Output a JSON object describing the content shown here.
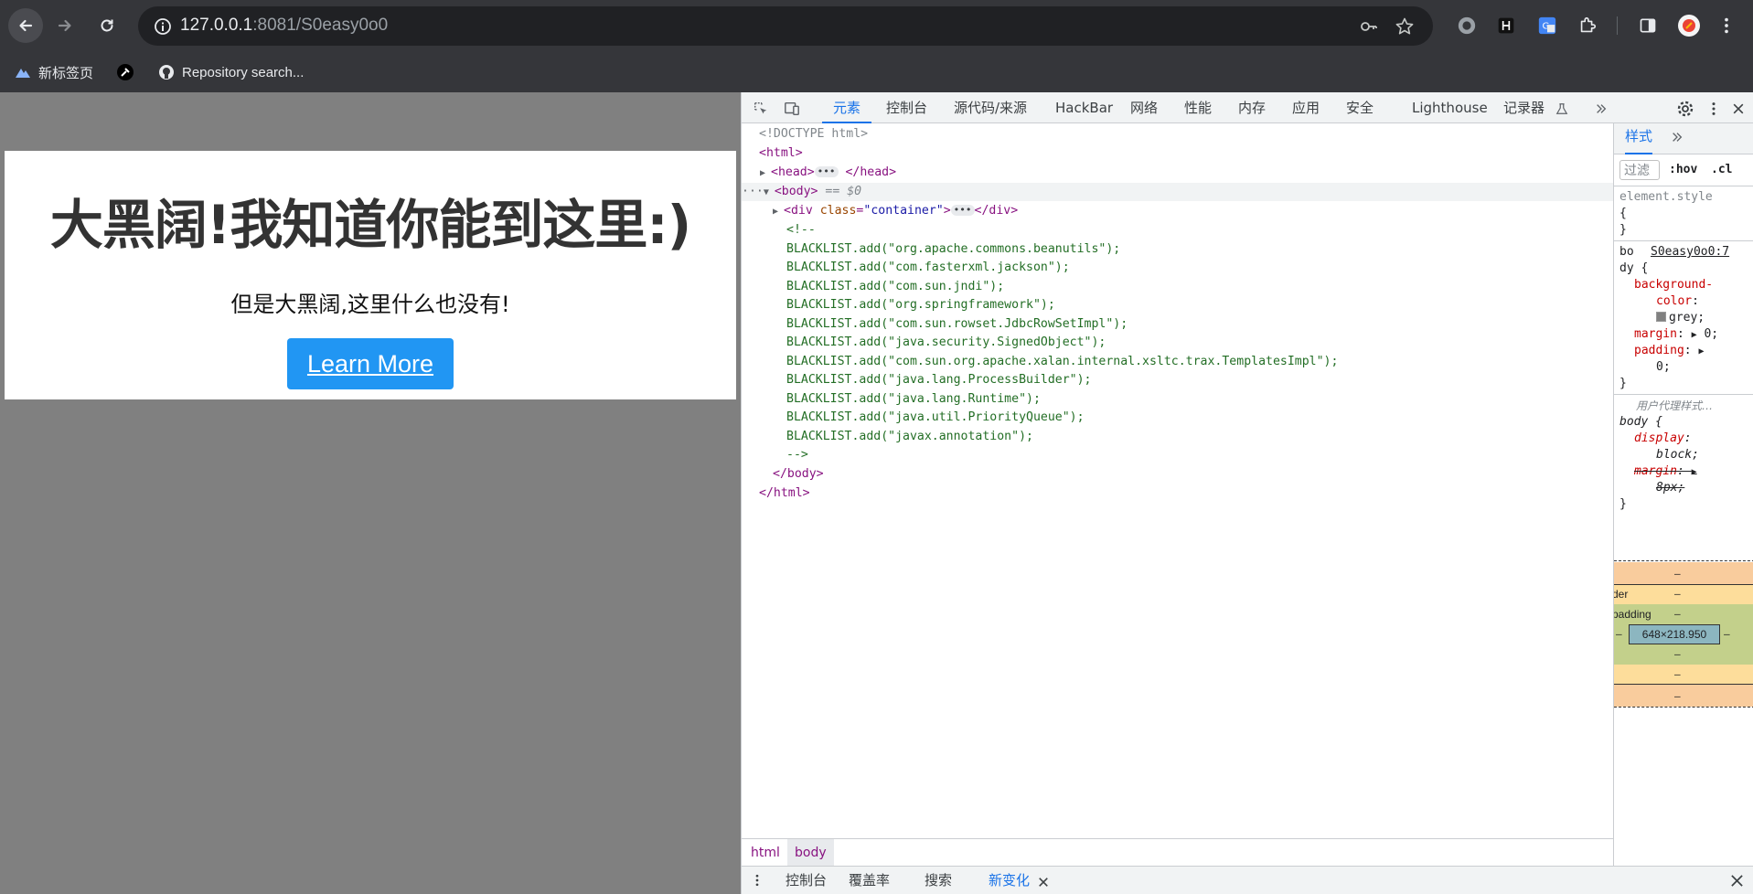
{
  "browser": {
    "url_host": "127.0.0.1",
    "url_rest": ":8081/S0easy0o0",
    "bookmarks": [
      {
        "label": "新标签页",
        "icon": "mountain-icon"
      },
      {
        "label": "",
        "icon": "tool-icon"
      },
      {
        "label": "Repository search...",
        "icon": "github-icon"
      }
    ]
  },
  "page": {
    "heading": "大黑阔!我知道你能到这里:)",
    "subtext": "但是大黑阔,这里什么也没有!",
    "button": "Learn More"
  },
  "devtools": {
    "tabs": [
      "元素",
      "控制台",
      "源代码/来源",
      "HackBar",
      "网络",
      "性能",
      "内存",
      "应用",
      "安全",
      "Lighthouse",
      "记录器"
    ],
    "dom": {
      "doctype": "<!DOCTYPE html>",
      "html_open": "<html>",
      "head": "<head>",
      "head_close": "</head>",
      "body_open": "<body>",
      "body_eq": "== $0",
      "div_open": "<div",
      "div_attr": "class",
      "div_attr_val": "\"container\"",
      "div_close": "</div>",
      "comment_open": "<!--",
      "blacklist": [
        "BLACKLIST.add(\"org.apache.commons.beanutils\");",
        "BLACKLIST.add(\"com.fasterxml.jackson\");",
        "BLACKLIST.add(\"com.sun.jndi\");",
        "BLACKLIST.add(\"org.springframework\");",
        "BLACKLIST.add(\"com.sun.rowset.JdbcRowSetImpl\");",
        "BLACKLIST.add(\"java.security.SignedObject\");",
        "BLACKLIST.add(\"com.sun.org.apache.xalan.internal.xsltc.trax.TemplatesImpl\");",
        "BLACKLIST.add(\"java.lang.ProcessBuilder\");",
        "BLACKLIST.add(\"java.lang.Runtime\");",
        "BLACKLIST.add(\"java.util.PriorityQueue\");",
        "BLACKLIST.add(\"javax.annotation\");"
      ],
      "comment_close": "-->",
      "body_close": "</body>",
      "html_close": "</html>"
    },
    "breadcrumbs": [
      "html",
      "body"
    ],
    "drawer_tabs": [
      "控制台",
      "覆盖率",
      "搜索",
      "新变化"
    ],
    "styles": {
      "tab": "样式",
      "filter": "过滤",
      "hov": ":hov",
      "cls": ".cl",
      "element_style": "element.style",
      "brace_open": "{",
      "brace_close": "}",
      "rule_selector_a": "bo",
      "rule_selector_b": "dy {",
      "rule_source": "S0easy0o0:7",
      "bg_prop_a": "background-",
      "bg_prop_b": "color",
      "bg_val": "grey;",
      "margin_prop": "margin",
      "margin_val": "0;",
      "padding_prop": "padding",
      "padding_val": "0;",
      "ua_label": "用户代理样式…",
      "ua_selector": "body {",
      "display_prop": "display",
      "display_val": "block;",
      "ua_margin_prop": "margin",
      "ua_margin_val": "8px;",
      "box_dims": "648×218.950",
      "box_dash": "–",
      "box_border_label": "der",
      "box_padding_label": "padding"
    },
    "colors": {
      "accent": "#1a73e8",
      "margin_box": "#f9cc9d",
      "border_box": "#fddd9b",
      "padding_box": "#c3d08b",
      "content_box": "#8cb6c0",
      "grey_swatch": "#808080"
    }
  }
}
